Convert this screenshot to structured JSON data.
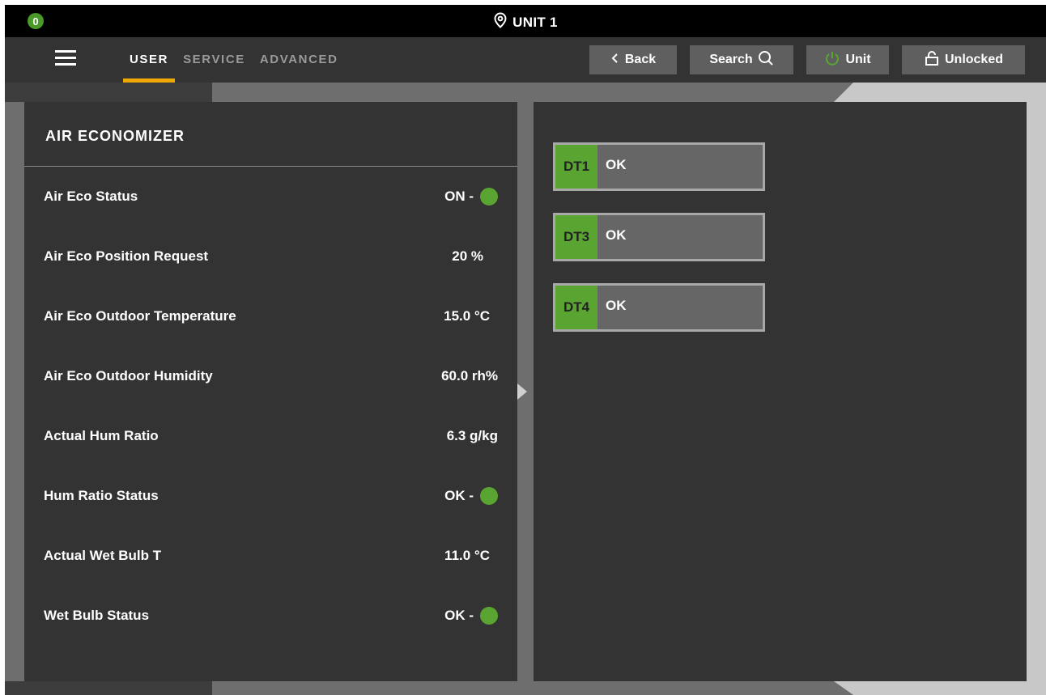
{
  "titlebar": {
    "alarm_count": "0",
    "unit_title": "UNIT 1"
  },
  "nav": {
    "tabs": [
      {
        "label": "USER",
        "active": true
      },
      {
        "label": "SERVICE",
        "active": false
      },
      {
        "label": "ADVANCED",
        "active": false
      }
    ],
    "back_label": "Back",
    "search_label": "Search",
    "unit_label": "Unit",
    "lock_label": "Unlocked"
  },
  "colors": {
    "accent": "#f0a800",
    "status_green": "#5aa532",
    "panel_bg": "#333333"
  },
  "left_panel": {
    "title": "AIR ECONOMIZER",
    "rows": [
      {
        "label": "Air Eco Status",
        "value": "ON  -",
        "dot": true
      },
      {
        "label": "Air Eco Position Request",
        "value": "20 %",
        "dot": false
      },
      {
        "label": "Air Eco Outdoor Temperature",
        "value": "15.0 °C",
        "dot": false
      },
      {
        "label": "Air Eco Outdoor Humidity",
        "value": "60.0 rh%",
        "dot": false
      },
      {
        "label": "Actual Hum Ratio",
        "value": "6.3 g/kg",
        "dot": false
      },
      {
        "label": "Hum Ratio Status",
        "value": "OK  -",
        "dot": true
      },
      {
        "label": "Actual Wet Bulb T",
        "value": "11.0 °C",
        "dot": false
      },
      {
        "label": "Wet Bulb Status",
        "value": "OK  -",
        "dot": true
      }
    ]
  },
  "right_panel": {
    "sensors": [
      {
        "tag": "DT1",
        "status": "OK"
      },
      {
        "tag": "DT3",
        "status": "OK"
      },
      {
        "tag": "DT4",
        "status": "OK"
      }
    ]
  }
}
